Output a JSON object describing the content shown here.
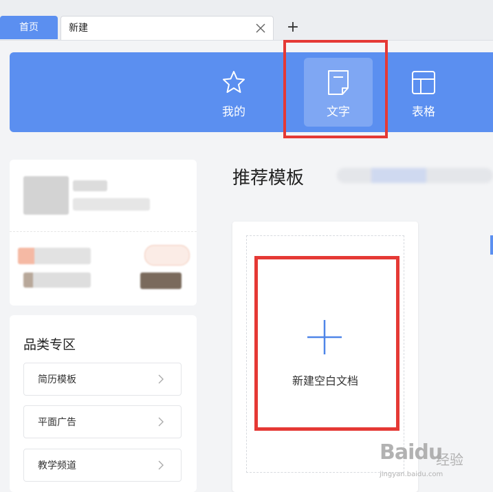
{
  "tabs": {
    "home_label": "首页",
    "new_label": "新建",
    "add_symbol": "+"
  },
  "header": {
    "items": [
      {
        "label": "我的",
        "icon": "star-icon"
      },
      {
        "label": "文字",
        "icon": "document-icon"
      },
      {
        "label": "表格",
        "icon": "table-icon"
      }
    ],
    "active_index": 1
  },
  "sidebar": {
    "category_title": "品类专区",
    "categories": [
      "简历模板",
      "平面广告",
      "教学频道"
    ]
  },
  "main": {
    "section_title": "推荐模板",
    "new_blank_label": "新建空白文档"
  },
  "watermark": {
    "logo": "Baidu",
    "suffix": "经验",
    "url": "jingyan.baidu.com"
  },
  "colors": {
    "accent": "#5b8ff0",
    "highlight": "#e53935"
  }
}
